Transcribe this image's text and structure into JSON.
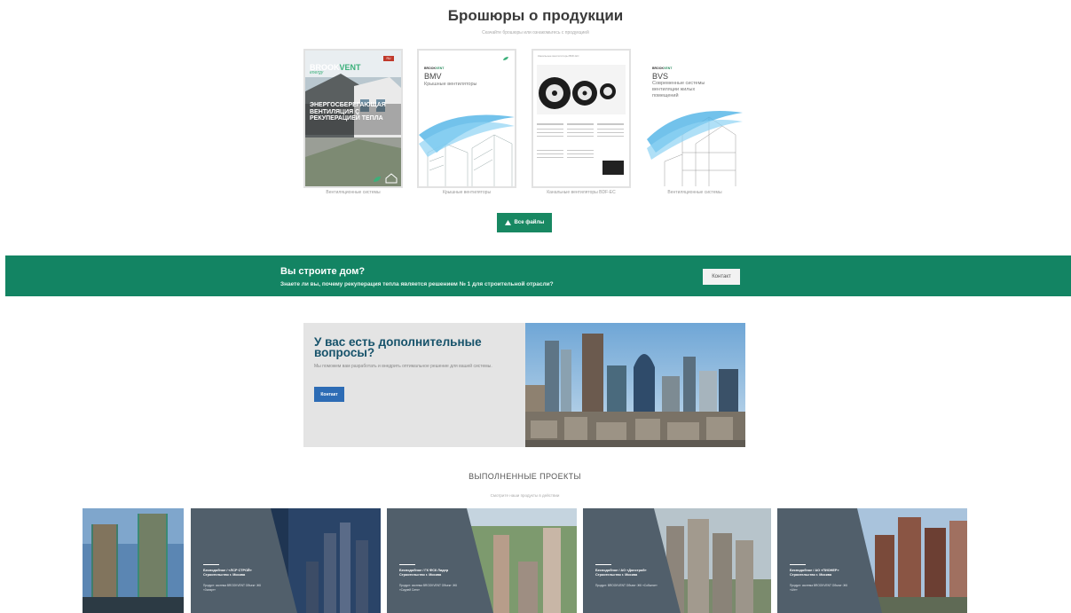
{
  "brochures": {
    "title": "Брошюры о продукции",
    "subtitle": "Скачайте брошюры или ознакомьтесь с продукцией",
    "items": [
      {
        "logo": "BROOK",
        "logo_accent": "VENT",
        "badge": "RU",
        "tagline": "energy",
        "headline": "ЭНЕРГОСБЕРЕГАЮЩАЯ ВЕНТИЛЯЦИЯ С РЕКУПЕРАЦИЕЙ ТЕПЛА",
        "caption": "Вентиляционные системы"
      },
      {
        "logo": "BROOK",
        "logo_accent": "VENT",
        "name": "BMV",
        "sub": "Крышные вентиляторы",
        "caption": "Крышные вентиляторы"
      },
      {
        "header": "Канальные вентиляторы BDF-EC",
        "caption": "Канальные вентиляторы BDF-EC"
      },
      {
        "logo": "BROOK",
        "logo_accent": "VENT",
        "name": "BVS",
        "sub": "Современные системы вентиляции жилых помещений",
        "caption": "Вентиляционные системы"
      }
    ],
    "all_files_label": "Все файлы"
  },
  "banner": {
    "heading": "Вы строите дом?",
    "text": "Знаете ли вы, почему рекуперация тепла является решением № 1 для строительной отрасли?",
    "button": "Контакт"
  },
  "questions": {
    "heading": "У вас есть дополнительные вопросы?",
    "text": "Мы поможем вам разработать и внедрить оптимальное решение для вашей системы.",
    "button": "Контакт"
  },
  "projects": {
    "title": "ВЫПОЛНЕННЫЕ ПРОЕКТЫ",
    "subtitle": "Смотрите наши продукты в действии",
    "items": [
      {
        "title": "",
        "sub": ""
      },
      {
        "title": "Бесподобное / «ЛСР СТРОЙ» Строительство г. Москва",
        "sub": "Продукт: система BROOKVENT Объект: ЖК «Зиларт»"
      },
      {
        "title": "Бесподобное / ГК ФСК Лидер Строительство г. Москва",
        "sub": "Продукт: система BROOKVENT Объект: ЖК «Сидней Сити»"
      },
      {
        "title": "Бесподобное / АО «Донстрой» Строительство г. Москва",
        "sub": "Продукт: BROOKVENT Объект: ЖК «Событие»"
      },
      {
        "title": "Бесподобное / АО «ПИОНЕР» Строительство г. Москва",
        "sub": "Продукт: система BROOKVENT Объект: ЖК «Life»"
      }
    ]
  },
  "colors": {
    "brand_green": "#138463",
    "button_blue": "#2d6cb5",
    "project_slate": "#515f6b"
  }
}
